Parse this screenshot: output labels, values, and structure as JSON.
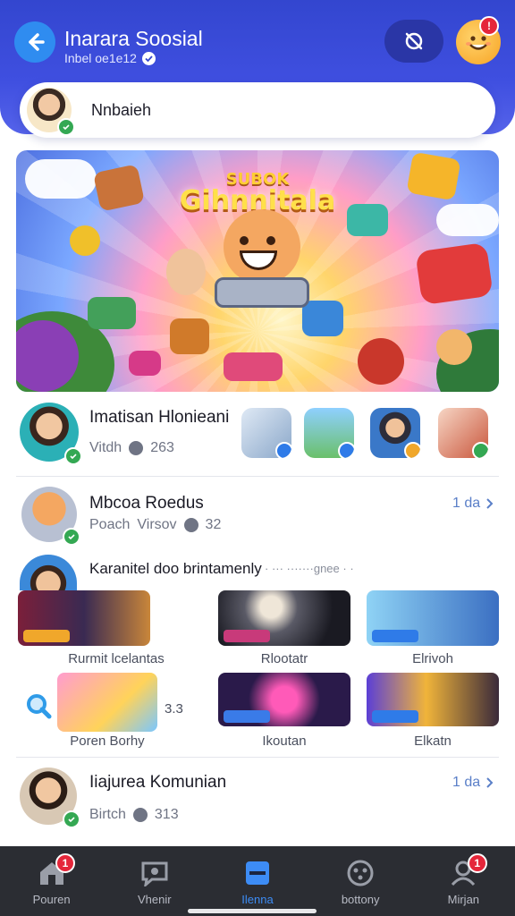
{
  "header": {
    "title": "Inarara Soosial",
    "subtitle": "Inbel oe1e12",
    "avatar_badge": "!",
    "colors": {
      "primary": "#3346cf",
      "accent": "#2f8cf0"
    }
  },
  "search": {
    "label": "Nnbaieh"
  },
  "banner": {
    "title_top": "SUBOK",
    "title_main": "Gihnnitala"
  },
  "feed": {
    "row1": {
      "title": "Imatisan Hlonieani",
      "meta_label": "Vitdh",
      "meta_count": "263"
    },
    "row2": {
      "title": "Mbcoa Roedus",
      "meta_label": "Poach",
      "meta_label2": "Virsov",
      "meta_count": "32",
      "link": "1 da"
    },
    "row3": {
      "title": "Karanitel doo brintamenly",
      "dots": "· ··· ·······gnee · ·"
    },
    "tiles": [
      {
        "caption": "Rurmit lcelantas"
      },
      {
        "caption": "Rlootatr"
      },
      {
        "caption": "Elrivoh"
      },
      {
        "caption": "Poren Borhy",
        "extra": "3.3"
      },
      {
        "caption": "Ikoutan"
      },
      {
        "caption": "Elkatn"
      }
    ],
    "row4": {
      "title": "Iiajurea Komunian",
      "meta_label": "Birtch",
      "meta_count": "313",
      "link": "1 da"
    }
  },
  "tabbar": {
    "tabs": [
      {
        "label": "Pouren",
        "badge": "1"
      },
      {
        "label": "Vhenir"
      },
      {
        "label": "Ilenna"
      },
      {
        "label": "bottony"
      },
      {
        "label": "Mirjan",
        "badge": "1"
      }
    ],
    "active": "Ilenna",
    "active_color": "#3d8cf5"
  }
}
